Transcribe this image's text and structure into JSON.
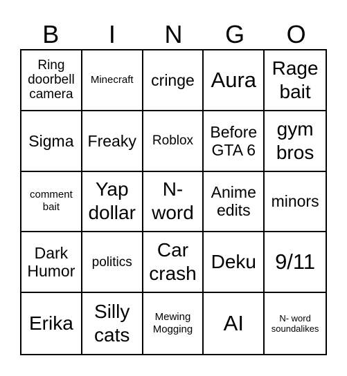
{
  "header": {
    "letters": [
      "B",
      "I",
      "N",
      "G",
      "O"
    ]
  },
  "cells": [
    "Ring doorbell camera",
    "Minecraft",
    "cringe",
    "Aura",
    "Rage bait",
    "Sigma",
    "Freaky",
    "Roblox",
    "Before GTA 6",
    "gym bros",
    "comment bait",
    "Yap dollar",
    "N- word",
    "Anime edits",
    "minors",
    "Dark Humor",
    "politics",
    "Car crash",
    "Deku",
    "9/11",
    "Erika",
    "Silly cats",
    "Mewing Mogging",
    "AI",
    "N- word soundalikes"
  ]
}
